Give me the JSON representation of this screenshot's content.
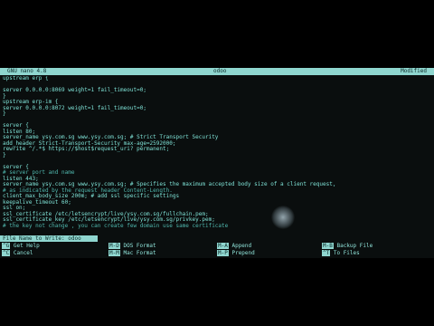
{
  "titlebar": {
    "app": "GNU nano 4.8",
    "file": "odoo",
    "status": "Modified"
  },
  "editor_lines": [
    {
      "text": "upstream erp {",
      "type": "code"
    },
    {
      "text": "",
      "type": "code"
    },
    {
      "text": "server 0.0.0.0:8069 weight=1 fail_timeout=0;",
      "type": "code"
    },
    {
      "text": "}",
      "type": "code"
    },
    {
      "text": "upstream erp-im {",
      "type": "code"
    },
    {
      "text": "server 0.0.0.0:8072 weight=1 fail_timeout=0;",
      "type": "code"
    },
    {
      "text": "}",
      "type": "code"
    },
    {
      "text": "",
      "type": "code"
    },
    {
      "text": "server {",
      "type": "code"
    },
    {
      "text": "listen 80;",
      "type": "code"
    },
    {
      "text": "server_name ysy.com.sg www.ysy.com.sg; # Strict Transport Security",
      "type": "code"
    },
    {
      "text": "add_header Strict-Transport-Security max-age=2592000;",
      "type": "code"
    },
    {
      "text": "rewrite ^/.*$ https://$host$request_uri? permanent;",
      "type": "code"
    },
    {
      "text": "}",
      "type": "code"
    },
    {
      "text": "",
      "type": "code"
    },
    {
      "text": "server {",
      "type": "code"
    },
    {
      "text": "# server port and name",
      "type": "comment"
    },
    {
      "text": "listen 443;",
      "type": "code"
    },
    {
      "text": "server_name ysy.com.sg www.ysy.com.sg; # Specifies the maximum accepted body size of a client request,",
      "type": "code"
    },
    {
      "text": "# as indicated by the request header Content-Length.",
      "type": "comment"
    },
    {
      "text": "client_max_body_size 200m; # add ssl specific settings",
      "type": "code"
    },
    {
      "text": "keepalive_timeout 60;",
      "type": "code"
    },
    {
      "text": "ssl on;",
      "type": "code"
    },
    {
      "text": "ssl_certificate /etc/letsencrypt/live/ysy.com.sg/fullchain.pem;",
      "type": "code"
    },
    {
      "text": "ssl_certificate_key /etc/letsencrypt/live/ysy.com.sg/privkey.pem;",
      "type": "code"
    },
    {
      "text": "# the key not change , you can create few domain use same certificate",
      "type": "comment"
    }
  ],
  "prompt": {
    "label": "File Name to Write:",
    "value": "odoo"
  },
  "shortcuts": [
    {
      "key": "^G",
      "label": "Get Help"
    },
    {
      "key": "^C",
      "label": "Cancel"
    },
    {
      "key": "M-D",
      "label": "DOS Format"
    },
    {
      "key": "M-M",
      "label": "Mac Format"
    },
    {
      "key": "M-A",
      "label": "Append"
    },
    {
      "key": "M-P",
      "label": "Prepend"
    },
    {
      "key": "M-B",
      "label": "Backup File"
    },
    {
      "key": "^T",
      "label": "To Files"
    }
  ]
}
